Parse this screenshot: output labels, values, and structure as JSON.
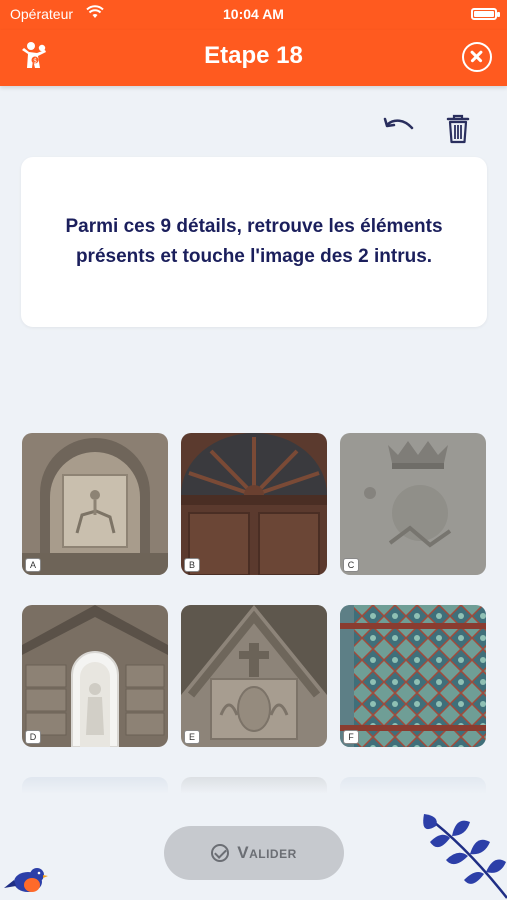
{
  "status": {
    "carrier": "Opérateur",
    "time": "10:04 AM"
  },
  "header": {
    "title": "Etape 18"
  },
  "instruction": "Parmi ces 9 détails, retrouve les éléments présents et touche l'image des 2 intrus.",
  "tiles": [
    {
      "label": "A",
      "subject": "carved relief of horseman in stone niche"
    },
    {
      "label": "B",
      "subject": "fanlight window above wooden door"
    },
    {
      "label": "C",
      "subject": "weathered stone carving with crown"
    },
    {
      "label": "D",
      "subject": "statue in white arched niche"
    },
    {
      "label": "E",
      "subject": "gable with cross and carved shield"
    },
    {
      "label": "F",
      "subject": "green diamond-pattern ironwork"
    }
  ],
  "actions": {
    "validate_label": "Valider"
  },
  "colors": {
    "brand": "#ff5a1f",
    "text_dark": "#1b1f5c",
    "background": "#eef2f7",
    "button_disabled": "#c6c9ce",
    "leaf_blue": "#2c3fa8"
  }
}
